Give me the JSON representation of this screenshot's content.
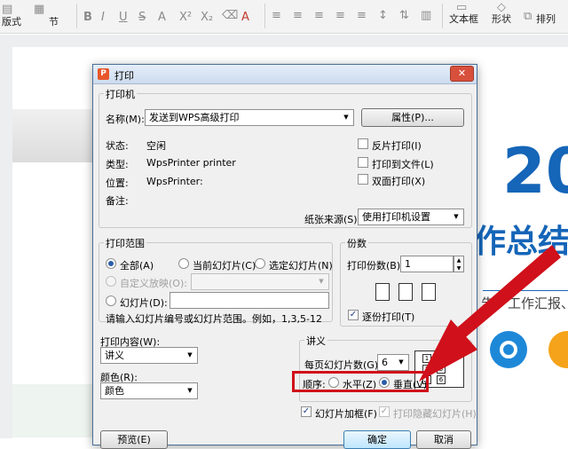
{
  "toolbar": {
    "layout_label": "版式",
    "section_label": "节",
    "text_box_label": "文本框",
    "shape_label": "形状",
    "arrange_label": "排列",
    "font_glyphs": [
      "B",
      "I",
      "U",
      "S",
      "A",
      "X²",
      "X₂",
      "A"
    ]
  },
  "slide": {
    "big_number": "20",
    "heading_fragment": "作总结",
    "text_fragment": "告、工作汇报、"
  },
  "dialog": {
    "title": "打印",
    "close": "✕",
    "printer": {
      "legend": "打印机",
      "name_label": "名称(M):",
      "name_value": "发送到WPS高级打印",
      "properties_button": "属性(P)...",
      "status_label": "状态:",
      "status_value": "空闲",
      "type_label": "类型:",
      "type_value": "WpsPrinter printer",
      "location_label": "位置:",
      "location_value": "WpsPrinter:",
      "comment_label": "备注:",
      "reverse_print": "反片打印(I)",
      "print_to_file": "打印到文件(L)",
      "duplex": "双面打印(X)",
      "paper_source_label": "纸张来源(S):",
      "paper_source_value": "使用打印机设置"
    },
    "range": {
      "legend": "打印范围",
      "all": "全部(A)",
      "current": "当前幻灯片(C)",
      "selected": "选定幻灯片(N)",
      "custom": "自定义放映(O):",
      "slides": "幻灯片(D):",
      "hint": "请输入幻灯片编号或幻灯片范围。例如，1,3,5-12"
    },
    "copies": {
      "legend": "份数",
      "count_label": "打印份数(B):",
      "count_value": "1",
      "collate": "逐份打印(T)"
    },
    "content": {
      "label": "打印内容(W):",
      "value": "讲义",
      "color_label": "颜色(R):",
      "color_value": "颜色"
    },
    "handout": {
      "legend": "讲义",
      "per_page_label": "每页幻灯片数(G):",
      "per_page_value": "6",
      "order_label": "顺序:",
      "horizontal": "水平(Z)",
      "vertical": "垂直(V)",
      "preview_numbers": [
        "1",
        "4",
        "2",
        "5",
        "3",
        "6"
      ]
    },
    "frame": "幻灯片加框(F)",
    "print_hidden": "打印隐藏幻灯片(H)",
    "preview_button": "预览(E)",
    "ok_button": "确定",
    "cancel_button": "取消"
  },
  "colors": {
    "accent_blue": "#1565b8",
    "highlight_red": "#d0101a",
    "close_red": "#d8503c"
  }
}
